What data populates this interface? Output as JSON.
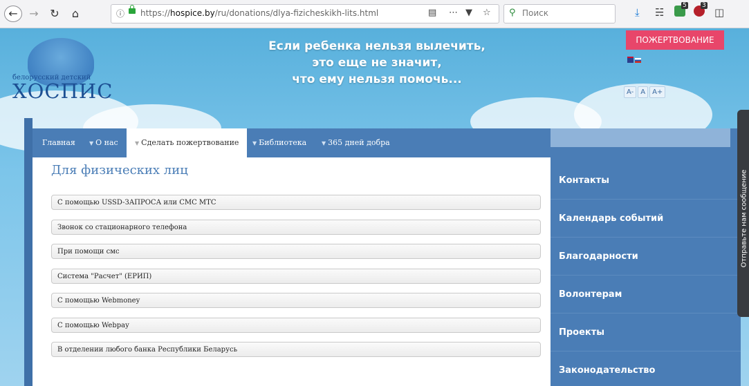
{
  "browser": {
    "url_prefix": "https://",
    "url_domain": "hospice.by",
    "url_path": "/ru/donations/dlya-fizicheskikh-lits.html",
    "search_placeholder": "Поиск",
    "ext_badge_1": "5",
    "ext_badge_2": "3"
  },
  "header": {
    "logo_small": "белорусский детский",
    "logo_big": "ХОСПИС",
    "slogan_line1": "Если ребенка нельзя вылечить,",
    "slogan_line2": "это еще не значит,",
    "slogan_line3": "что ему нельзя помочь...",
    "donate_label": "ПОЖЕРТВОВАНИЕ",
    "font_minus": "A-",
    "font_normal": "A",
    "font_plus": "A+"
  },
  "nav": {
    "items": [
      "Главная",
      "О нас",
      "Сделать пожертвование",
      "Библиотека",
      "365 дней добра"
    ]
  },
  "main": {
    "title": "Для физических лиц",
    "accordion": [
      "С помощью USSD-ЗАПРОСА или СМС МТС",
      "Звонок со стационарного телефона",
      "При помощи смс",
      "Система \"Расчет\" (ЕРИП)",
      "С помощью Webmoney",
      "С помощью Webpay",
      "В отделении любого банка Республики Беларусь"
    ]
  },
  "sidebar": {
    "items": [
      "Контакты",
      "Календарь событий",
      "Благодарности",
      "Волонтерам",
      "Проекты",
      "Законодательство"
    ]
  },
  "feedback": {
    "label": "Отправьте нам сообщение"
  }
}
